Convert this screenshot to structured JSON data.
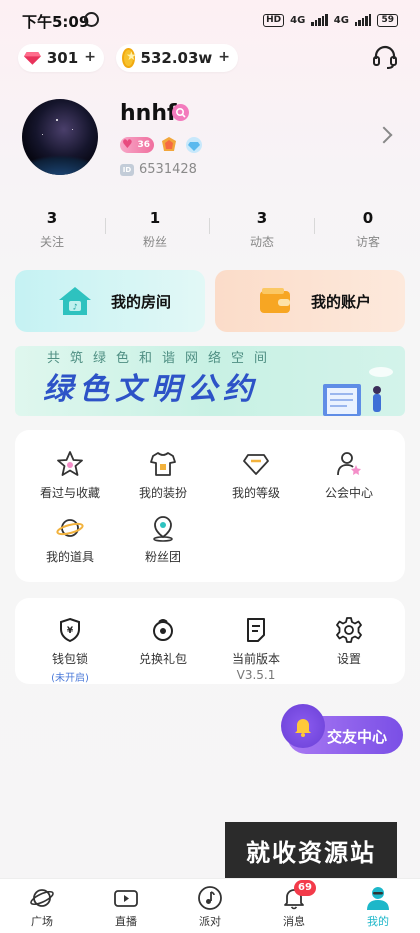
{
  "status_bar": {
    "time": "下午5:09",
    "hd": "HD",
    "net1": "4G",
    "net2": "4G",
    "battery": "59"
  },
  "currency": {
    "gems": "301",
    "coins": "532.03w",
    "plus": "+"
  },
  "profile": {
    "username": "hnhf",
    "vip_level": "36",
    "uid": "6531428"
  },
  "stats": [
    {
      "value": "3",
      "label": "关注"
    },
    {
      "value": "1",
      "label": "粉丝"
    },
    {
      "value": "3",
      "label": "动态"
    },
    {
      "value": "0",
      "label": "访客"
    }
  ],
  "cards": {
    "room": "我的房间",
    "account": "我的账户"
  },
  "banner": {
    "subtitle": "共筑绿色和谐网络空间",
    "title": "绿色文明公约"
  },
  "menu1": [
    {
      "label": "看过与收藏",
      "icon": "star-box-icon"
    },
    {
      "label": "我的装扮",
      "icon": "shirt-icon"
    },
    {
      "label": "我的等级",
      "icon": "diamond-icon"
    },
    {
      "label": "公会中心",
      "icon": "person-star-icon"
    },
    {
      "label": "我的道具",
      "icon": "planet-icon"
    },
    {
      "label": "粉丝团",
      "icon": "location-icon"
    }
  ],
  "menu2": [
    {
      "label": "钱包锁",
      "sub": "(未开启)",
      "icon": "shield-yen-icon"
    },
    {
      "label": "兑换礼包",
      "sub": "",
      "icon": "gift-bag-icon"
    },
    {
      "label": "当前版本",
      "sub": "V3.5.1",
      "icon": "document-icon"
    },
    {
      "label": "设置",
      "sub": "",
      "icon": "gear-icon"
    }
  ],
  "float": {
    "friend_center": "交友中心"
  },
  "watermark": "就收资源站",
  "nav": [
    {
      "label": "广场"
    },
    {
      "label": "直播"
    },
    {
      "label": "派对"
    },
    {
      "label": "消息",
      "badge": "69"
    },
    {
      "label": "我的"
    }
  ],
  "colors": {
    "accent": "#1db7c9",
    "badge_red": "#f33b4a",
    "link_blue": "#4a79d9",
    "banner_title": "#2d53c7"
  }
}
